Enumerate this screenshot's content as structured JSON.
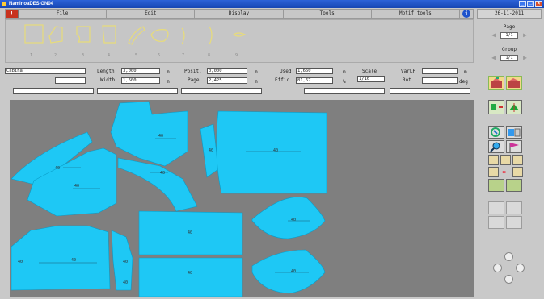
{
  "window": {
    "title": "NaminoaDESIGN04",
    "icon": "app-icon",
    "buttons": [
      "minimize-icon",
      "maximize-icon",
      "close-icon"
    ]
  },
  "menu": {
    "items": [
      "File",
      "Edit",
      "Display",
      "Tools",
      "Motif tools"
    ],
    "alert_icon": "!",
    "info_icon": "i"
  },
  "date": "26-11-2011",
  "right_panel": {
    "page_label": "Page",
    "page_value": "1/1",
    "group_label": "Group",
    "group_value": "1/1"
  },
  "fields": {
    "name": "Cabina",
    "length_label": "Length",
    "length_value": "3,000",
    "length_unit": "m",
    "width_label": "Width",
    "width_value": "1,600",
    "width_unit": "m",
    "posit_label": "Posit.",
    "posit_value": "0,000",
    "posit_unit": "m",
    "page_label": "Page",
    "page_value": "2,425",
    "page_unit": "m",
    "used_label": "Used",
    "used_value": "1,660",
    "used_unit": "m",
    "effic_label": "Effic.",
    "effic_value": "81,67",
    "effic_unit": "%",
    "scale_label": "Scale",
    "scale_value": "1/16",
    "varlp_label": "VarLP",
    "varlp_value": "",
    "varlp_unit": "m",
    "rot_label": "Rot.",
    "rot_value": "",
    "rot_unit": "deg"
  },
  "canvas": {
    "piece_color": "#1ec8f5",
    "background": "#7f7f7f",
    "guide_color": "#1bd14a",
    "labels": [
      "40",
      "40",
      "40",
      "40",
      "40",
      "40",
      "40",
      "40",
      "40",
      "40",
      "40",
      "40",
      "40",
      "40"
    ]
  },
  "colors": {
    "titlebar": "#1e50c0",
    "alert": "#c8321e"
  }
}
